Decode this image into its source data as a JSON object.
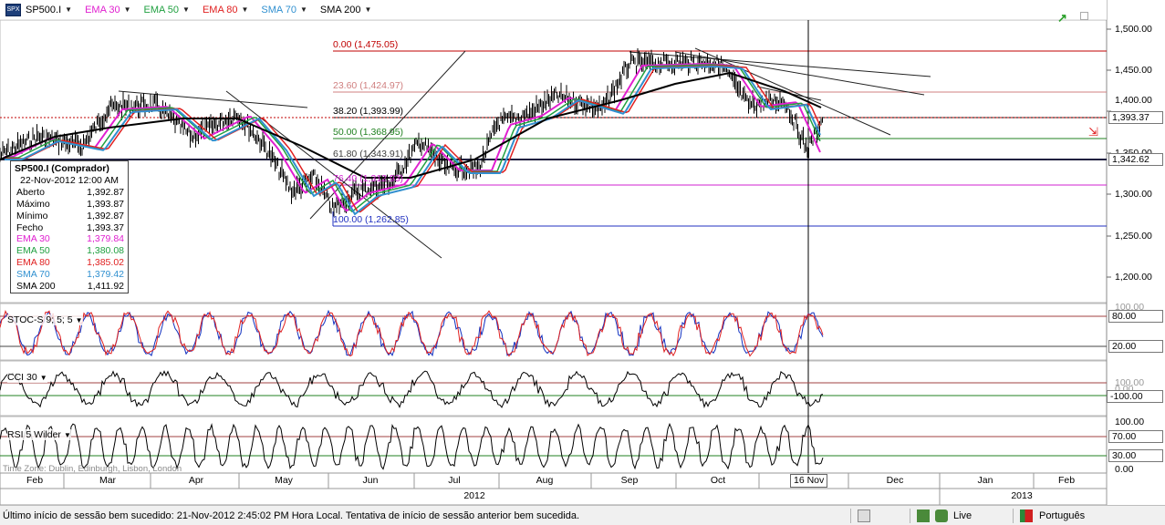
{
  "toolbar": {
    "symbol": "SP500.I",
    "indicators": [
      {
        "label": "EMA 30",
        "color": "#e020d0"
      },
      {
        "label": "EMA 50",
        "color": "#20a040"
      },
      {
        "label": "EMA 80",
        "color": "#e02020"
      },
      {
        "label": "SMA 70",
        "color": "#3090d0"
      },
      {
        "label": "SMA 200",
        "color": "#000000"
      }
    ]
  },
  "price_axis": [
    "1,500.00",
    "1,450.00",
    "1,400.00",
    "1,350.00",
    "1,300.00",
    "1,250.00",
    "1,200.00"
  ],
  "price_badges": {
    "last": "1,393.37",
    "cross": "1,342.62"
  },
  "fibonacci": [
    {
      "label": "0.00 (1,475.05)",
      "color": "#c00000"
    },
    {
      "label": "23.60 (1,424.97)",
      "color": "#d08080"
    },
    {
      "label": "38.20 (1,393.99)",
      "color": "#000000"
    },
    {
      "label": "50.00 (1,368.95)",
      "color": "#208020"
    },
    {
      "label": "61.80 (1,343.91)",
      "color": "#404040"
    },
    {
      "label": "76.40 (1,312.93)",
      "color": "#d020d0"
    },
    {
      "label": "100.00 (1,262.85)",
      "color": "#2030c0"
    }
  ],
  "info": {
    "title": "SP500.I (Comprador)",
    "date": "22-Nov-2012 12:00 AM",
    "rows": [
      {
        "k": "Aberto",
        "v": "1,392.87",
        "c": "#000"
      },
      {
        "k": "Máximo",
        "v": "1,393.87",
        "c": "#000"
      },
      {
        "k": "Mínimo",
        "v": "1,392.87",
        "c": "#000"
      },
      {
        "k": "Fecho",
        "v": "1,393.37",
        "c": "#000"
      },
      {
        "k": "EMA 30",
        "v": "1,379.84",
        "c": "#e020d0"
      },
      {
        "k": "EMA 50",
        "v": "1,380.08",
        "c": "#20a040"
      },
      {
        "k": "EMA 80",
        "v": "1,385.02",
        "c": "#e02020"
      },
      {
        "k": "SMA 70",
        "v": "1,379.42",
        "c": "#3090d0"
      },
      {
        "k": "SMA 200",
        "v": "1,411.92",
        "c": "#000"
      }
    ]
  },
  "panes": {
    "stoch": {
      "label": "STOC-S 9; 5; 5",
      "levels": [
        "80.00",
        "20.00"
      ],
      "top": "100.00"
    },
    "cci": {
      "label": "CCI 30",
      "levels": [
        "100.00",
        "0.00",
        "-100.00"
      ]
    },
    "rsi": {
      "label": "RSI 5 Wilder",
      "levels": [
        "100.00",
        "70.00",
        "30.00",
        "0.00"
      ]
    }
  },
  "timezone": "Time Zone: Dublin, Edinburgh, Lisbon, London",
  "months": [
    "Feb",
    "Mar",
    "Apr",
    "May",
    "Jun",
    "Jul",
    "Aug",
    "Sep",
    "Oct",
    "Nov",
    "Dec",
    "Jan",
    "Feb"
  ],
  "years": [
    "2012",
    "2013"
  ],
  "crosshair_date": "16 Nov",
  "status": {
    "message": "Último início de sessão bem sucedido: 21-Nov-2012 2:45:02 PM Hora Local. Tentativa de início de sessão anterior bem sucedida.",
    "connection": "Live",
    "language": "Português"
  }
}
